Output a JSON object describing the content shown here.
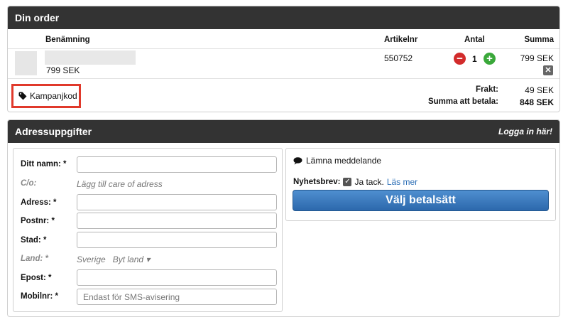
{
  "order": {
    "title": "Din order",
    "columns": {
      "name": "Benämning",
      "artno": "Artikelnr",
      "qty": "Antal",
      "sum": "Summa"
    },
    "item": {
      "price": "799 SEK",
      "artno": "550752",
      "qty": "1",
      "sum": "799 SEK",
      "qty_minus": "−",
      "qty_plus": "+",
      "remove": "✕"
    },
    "campaign_label": "Kampanjkod",
    "shipping_label": "Frakt:",
    "shipping_value": "49 SEK",
    "total_label": "Summa att betala:",
    "total_value": "848 SEK",
    "colors": {
      "highlight": "#e0392b",
      "minus": "#d22b2b",
      "plus": "#3aa83a"
    }
  },
  "address": {
    "title": "Adressuppgifter",
    "login_link": "Logga in här!",
    "fields": {
      "name_label": "Ditt namn: *",
      "co_label": "C/o:",
      "co_hint": "Lägg till care of adress",
      "address_label": "Adress: *",
      "postnr_label": "Postnr: *",
      "city_label": "Stad: *",
      "country_label": "Land: *",
      "country_value": "Sverige",
      "country_change": "Byt land ▾",
      "email_label": "Epost: *",
      "mobile_label": "Mobilnr: *",
      "mobile_placeholder": "Endast för SMS-avisering"
    },
    "message_label": "Lämna meddelande",
    "newsletter_label": "Nyhetsbrev:",
    "newsletter_check": "✓",
    "newsletter_text": "Ja tack.",
    "read_more": "Läs mer",
    "pay_button": "Välj betalsätt",
    "colors": {
      "header": "#333333",
      "pay_button": "#3a78bd",
      "link": "#2a6db5"
    }
  }
}
